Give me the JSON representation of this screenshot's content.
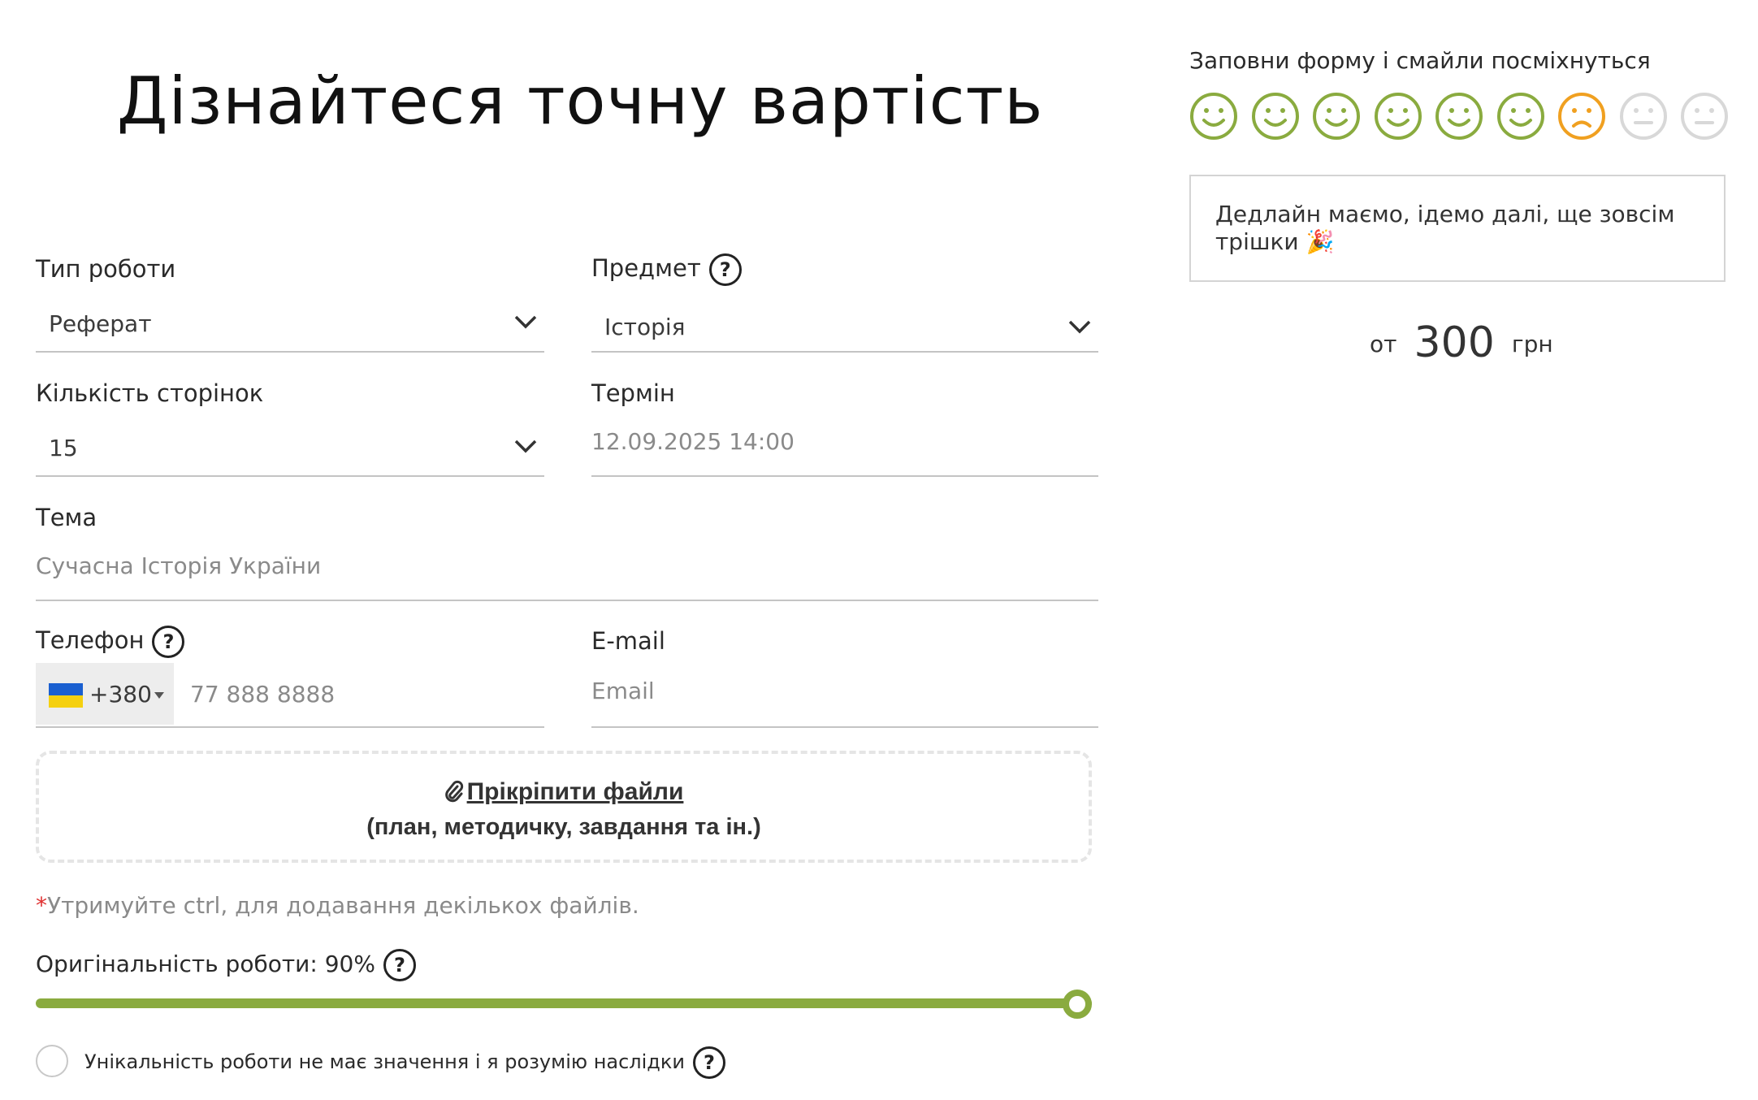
{
  "title": "Дізнайтеся точну вартість",
  "form": {
    "work_type": {
      "label": "Тип роботи",
      "value": "Реферат"
    },
    "subject": {
      "label": "Предмет",
      "value": "Історія"
    },
    "pages": {
      "label": "Кількість сторінок",
      "value": "15"
    },
    "deadline": {
      "label": "Термін",
      "value": "12.09.2025 14:00"
    },
    "topic": {
      "label": "Тема",
      "placeholder": "Сучасна Історія України"
    },
    "phone": {
      "label": "Телефон",
      "code": "+380",
      "placeholder": "77 888 8888"
    },
    "email": {
      "label": "E-mail",
      "placeholder": "Email"
    },
    "upload": {
      "link": "Прікріпити файли",
      "sub": "(план, методичку, завдання та ін.)"
    },
    "hint": {
      "star": "*",
      "text": "Утримуйте ctrl, для додавання декількох файлів."
    },
    "originality": {
      "label": "Оригінальність роботи:",
      "value_text": "90%",
      "value": 90
    },
    "uniqueness_checkbox": {
      "label": "Унікальність роботи не має значення і я розумію наслідки",
      "checked": false
    },
    "help_symbol": "?"
  },
  "sidebar": {
    "smiley_caption": "Заповни форму і смайли посміхнуться",
    "smileys": [
      "happy",
      "happy",
      "happy",
      "happy",
      "happy",
      "happy",
      "sad",
      "neutral",
      "neutral"
    ],
    "smiley_colors": {
      "happy": "#8aab3f",
      "sad": "#f0a020",
      "neutral": "#d8d8d8"
    },
    "tip": "Дедлайн маємо, ідемо далі, ще зовсім трішки 🎉",
    "price": {
      "prefix": "от",
      "amount": "300",
      "currency": "грн"
    }
  },
  "colors": {
    "accent": "#8aab3f"
  }
}
